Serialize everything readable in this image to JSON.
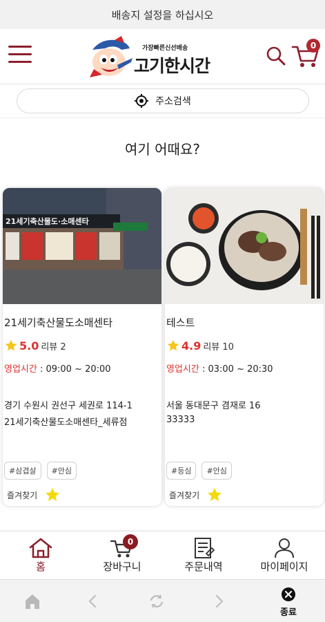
{
  "topbar": {
    "text": "배송지 설정을 하십시오"
  },
  "header": {
    "logo_tagline": "가장빠른신선배송",
    "logo_name": "고기한시간",
    "cart_count": "0"
  },
  "address_search": {
    "label": "주소검색"
  },
  "section": {
    "title": "여기 어때요?"
  },
  "stores": [
    {
      "name": "21세기축산물도소매센타",
      "rating": "5.0",
      "review_label": "리뷰 2",
      "hours_label": "영업시간",
      "hours_value": " : 09:00 ~ 20:00",
      "address_line1": "경기 수원시 권선구 세권로 114-1",
      "address_line2": "21세기축산물도소매센타_세류점",
      "tags": [
        "#삼겹살",
        "#안심"
      ],
      "favorite_label": "즐겨찾기",
      "sign_text": "21세기축산물도·소매센타"
    },
    {
      "name": "테스트",
      "rating": "4.9",
      "review_label": "리뷰 10",
      "hours_label": "영업시간",
      "hours_value": " : 03:00 ~ 20:30",
      "address_line1": "서울 동대문구 겸재로 16",
      "address_line2": "33333",
      "tags": [
        "#등심",
        "#안심"
      ],
      "favorite_label": "즐겨찾기"
    }
  ],
  "bottom_nav": {
    "items": [
      {
        "label": "홈",
        "icon": "home-icon"
      },
      {
        "label": "장바구니",
        "icon": "cart-icon",
        "badge": "0"
      },
      {
        "label": "주문내역",
        "icon": "order-list-icon"
      },
      {
        "label": "마이페이지",
        "icon": "user-icon"
      }
    ]
  },
  "browser_bar": {
    "exit_label": "종료"
  },
  "colors": {
    "brand": "#8b1f2c",
    "accent_red": "#e0302c",
    "star": "#f5c518"
  }
}
